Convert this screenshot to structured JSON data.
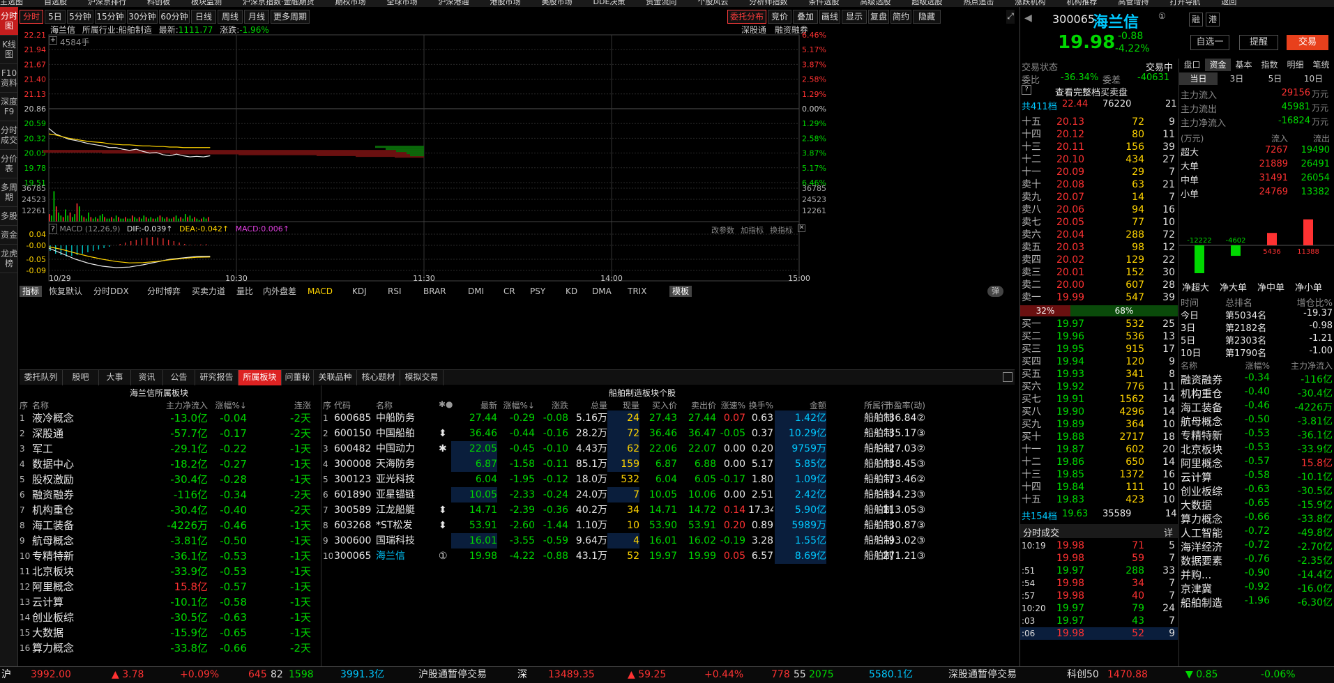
{
  "menu": [
    "主选图",
    "自选股",
    "沪深京排行",
    "科创板",
    "板块监测",
    "沪深京指数·金融期货",
    "期权市场",
    "全球市场",
    "沪深港通",
    "港股市场",
    "美股市场",
    "DDE决策",
    "资金流向",
    "个股风云",
    "分析师指数",
    "条件选股",
    "高级选股",
    "超级选股",
    "热点追击",
    "涨跌机构",
    "机构推荐",
    "高管增持",
    "打开导航",
    "返回"
  ],
  "sidebar": [
    {
      "label": "分时图",
      "active": true
    },
    {
      "label": "K线图"
    },
    {
      "label": "F10资料"
    },
    {
      "label": "深度F9"
    },
    {
      "label": "分时成交"
    },
    {
      "label": "分价表"
    },
    {
      "label": "多周期"
    },
    {
      "label": "多股"
    },
    {
      "label": "资金"
    },
    {
      "label": "龙虎榜"
    }
  ],
  "toolbar": {
    "left": [
      "分时",
      "5日",
      "5分钟",
      "15分钟",
      "30分钟",
      "60分钟",
      "日线",
      "周线",
      "月线",
      "更多周期"
    ],
    "right": [
      "委托分布",
      "竞价",
      "叠加",
      "画线",
      "显示",
      "复盘",
      "简约",
      "隐藏"
    ]
  },
  "chart": {
    "title": "海兰信",
    "industry_label": "所属行业:",
    "industry": "船舶制造",
    "latest_label": "最新:",
    "latest": "1111.77",
    "chg_label": "涨跌:",
    "chg": "-1.96%",
    "link1": "深股通",
    "link2": "融资融券",
    "volume_marker": "4584手",
    "price_ticks": [
      "22.21",
      "21.94",
      "21.67",
      "21.40",
      "21.13",
      "20.86",
      "20.59",
      "20.32",
      "20.05",
      "19.78",
      "19.51"
    ],
    "pct_ticks": [
      "6.46%",
      "5.17%",
      "3.87%",
      "2.58%",
      "1.29%",
      "0.00%",
      "1.29%",
      "2.58%",
      "3.87%",
      "5.17%",
      "6.46%"
    ],
    "vol_ticks": [
      "36785",
      "24523",
      "12261"
    ],
    "macd_label": "MACD (12,26,9)",
    "dif": "DIF:-0.039↑",
    "dea": "DEA:-0.042↑",
    "macd": "MACD:0.006↑",
    "macd_ticks": [
      "0.04",
      "-0.00",
      "-0.05",
      "-0.09"
    ],
    "macd_links": [
      "改参数",
      "加指标",
      "换指标"
    ],
    "times": [
      "10/29",
      "10:30",
      "11:30",
      "14:00",
      "15:00"
    ],
    "indicators": [
      "指标",
      "恢复默认",
      "分时DDX",
      "分时博弈",
      "买卖力道",
      "量比",
      "内外盘差",
      "MACD",
      "KDJ",
      "RSI",
      "BRAR",
      "DMI",
      "CR",
      "PSY",
      "KD",
      "DMA",
      "TRIX",
      "模板"
    ],
    "toggle": "弹",
    "price_line": [
      20.5,
      20.4,
      20.35,
      20.3,
      20.28,
      20.25,
      20.22,
      20.2,
      20.18,
      20.15,
      20.15,
      20.12,
      20.1,
      20.12,
      20.08,
      20.05,
      20.06,
      20.02,
      20.0,
      20.03,
      20.0,
      19.98,
      19.99,
      19.98,
      20.0
    ],
    "avg_line": [
      20.4,
      20.38,
      20.35,
      20.32,
      20.3,
      20.28,
      20.26,
      20.25,
      20.24,
      20.22,
      20.21,
      20.2,
      20.2,
      20.19,
      20.18,
      20.18,
      20.17,
      20.17,
      20.16,
      20.16,
      20.15,
      20.15,
      20.15,
      20.15,
      20.15
    ],
    "vols": [
      5,
      4,
      20,
      10,
      6,
      4,
      3,
      8,
      4,
      6,
      3,
      5,
      12,
      10,
      4,
      3,
      2,
      6,
      3,
      2,
      3,
      2,
      4,
      5,
      3,
      2,
      2,
      3,
      2,
      4,
      3,
      2,
      2,
      3,
      2,
      2,
      4,
      3,
      2,
      3,
      2,
      4,
      3,
      2,
      3,
      2,
      2,
      3,
      4,
      3,
      2,
      3,
      2,
      2,
      3,
      4,
      2,
      3,
      2,
      5,
      3,
      4,
      2,
      3,
      2,
      1,
      2,
      3,
      2,
      3
    ],
    "macd_bars": [
      -0.02,
      -0.03,
      -0.035,
      -0.04,
      -0.038,
      -0.035,
      -0.03,
      -0.025,
      -0.02,
      -0.015,
      -0.01,
      -0.005,
      0.0,
      0.005,
      0.01,
      0.015,
      0.02,
      0.025,
      0.028,
      0.03,
      0.028,
      0.025,
      0.02,
      0.015,
      0.01,
      0.005,
      0.002,
      0.001,
      0.003,
      0.004
    ],
    "dif_line": [
      -0.01,
      -0.03,
      -0.05,
      -0.065,
      -0.075,
      -0.08,
      -0.078,
      -0.07,
      -0.06,
      -0.05,
      -0.045,
      -0.04,
      -0.039
    ],
    "dea_line": [
      -0.005,
      -0.015,
      -0.028,
      -0.04,
      -0.05,
      -0.058,
      -0.063,
      -0.062,
      -0.058,
      -0.052,
      -0.047,
      -0.043,
      -0.042
    ],
    "depth_green": [
      8,
      10,
      16,
      22,
      28
    ],
    "depth_red": [
      6,
      14,
      22,
      38,
      52,
      66,
      78
    ]
  },
  "btabs": [
    "委托队列",
    "股吧",
    "大事",
    "资讯",
    "公告",
    "研究报告",
    "所属板块",
    "问董秘",
    "关联品种",
    "核心题材",
    "模拟交易"
  ],
  "left_table": {
    "title": "海兰信所属板块",
    "headers": [
      "序",
      "名称",
      "主力净流入",
      "涨幅%↓",
      "连涨"
    ],
    "rows": [
      [
        "1",
        "液冷概念",
        "-13.0亿",
        "-0.04",
        "-2天"
      ],
      [
        "2",
        "深股通",
        "-57.7亿",
        "-0.17",
        "-2天"
      ],
      [
        "3",
        "军工",
        "-29.1亿",
        "-0.22",
        "-1天"
      ],
      [
        "4",
        "数据中心",
        "-18.2亿",
        "-0.27",
        "-1天"
      ],
      [
        "5",
        "股权激励",
        "-30.4亿",
        "-0.28",
        "-1天"
      ],
      [
        "6",
        "融资融券",
        "-116亿",
        "-0.34",
        "-2天"
      ],
      [
        "7",
        "机构重仓",
        "-30.4亿",
        "-0.40",
        "-2天"
      ],
      [
        "8",
        "海工装备",
        "-4226万",
        "-0.46",
        "-1天"
      ],
      [
        "9",
        "航母概念",
        "-3.81亿",
        "-0.50",
        "-1天"
      ],
      [
        "10",
        "专精特新",
        "-36.1亿",
        "-0.53",
        "-1天"
      ],
      [
        "11",
        "北京板块",
        "-33.9亿",
        "-0.53",
        "-1天"
      ],
      [
        "12",
        "阿里概念",
        "15.8亿",
        "-0.57",
        "-1天"
      ],
      [
        "13",
        "云计算",
        "-10.1亿",
        "-0.58",
        "-1天"
      ],
      [
        "14",
        "创业板综",
        "-30.5亿",
        "-0.63",
        "-1天"
      ],
      [
        "15",
        "大数据",
        "-15.9亿",
        "-0.65",
        "-1天"
      ],
      [
        "16",
        "算力概念",
        "-33.8亿",
        "-0.66",
        "-2天"
      ]
    ]
  },
  "right_table": {
    "title": "船舶制造板块个股",
    "headers": [
      "序",
      "代码",
      "名称",
      "✱●",
      "最新",
      "涨幅%↓",
      "涨跌",
      "总量",
      "现量",
      "买入价",
      "卖出价",
      "涨速%",
      "换手%",
      "金额",
      "市盈率(动)",
      "所属行"
    ],
    "rows": [
      [
        "1",
        "600685",
        "中船防务",
        "",
        "27.44",
        "-0.29",
        "-0.08",
        "5.16万",
        "24",
        "27.43",
        "27.44",
        "0.07",
        "0.63",
        "1.42亿",
        "36.84②",
        "船舶制"
      ],
      [
        "2",
        "600150",
        "中国船舶",
        "⬍",
        "36.46",
        "-0.44",
        "-0.16",
        "28.2万",
        "72",
        "36.46",
        "36.47",
        "-0.05",
        "0.37",
        "10.29亿",
        "35.17③",
        "船舶制"
      ],
      [
        "3",
        "600482",
        "中国动力",
        "✱",
        "22.05",
        "-0.45",
        "-0.10",
        "4.43万",
        "62",
        "22.06",
        "22.07",
        "0.00",
        "0.20",
        "9759万",
        "27.03②",
        "船舶制"
      ],
      [
        "4",
        "300008",
        "天海防务",
        "",
        "6.87",
        "-1.58",
        "-0.11",
        "85.1万",
        "159",
        "6.87",
        "6.88",
        "0.00",
        "5.17",
        "5.85亿",
        "38.45③",
        "船舶制"
      ],
      [
        "5",
        "300123",
        "亚光科技",
        "",
        "6.04",
        "-1.95",
        "-0.12",
        "18.0万",
        "532",
        "6.04",
        "6.05",
        "-0.17",
        "1.80",
        "1.09亿",
        "-73.46②",
        "船舶制"
      ],
      [
        "6",
        "601890",
        "亚星锚链",
        "",
        "10.05",
        "-2.33",
        "-0.24",
        "24.0万",
        "7",
        "10.05",
        "10.06",
        "0.00",
        "2.51",
        "2.42亿",
        "34.23③",
        "船舶制"
      ],
      [
        "7",
        "300589",
        "江龙船艇",
        "⬍",
        "14.71",
        "-2.39",
        "-0.36",
        "40.2万",
        "34",
        "14.71",
        "14.72",
        "0.14",
        "17.34",
        "5.90亿",
        "-113.05③",
        "船舶制"
      ],
      [
        "8",
        "603268",
        "*ST松发",
        "⬍",
        "53.91",
        "-2.60",
        "-1.44",
        "1.10万",
        "10",
        "53.90",
        "53.91",
        "0.20",
        "0.89",
        "5989万",
        "30.87③",
        "船舶制"
      ],
      [
        "9",
        "300600",
        "国瑞科技",
        "",
        "16.01",
        "-3.55",
        "-0.59",
        "9.64万",
        "4",
        "16.01",
        "16.02",
        "-0.19",
        "3.28",
        "1.55亿",
        "-93.02③",
        "船舶制"
      ],
      [
        "10",
        "300065",
        "海兰信",
        "①",
        "19.98",
        "-4.22",
        "-0.88",
        "43.1万",
        "52",
        "19.97",
        "19.99",
        "0.05",
        "6.57",
        "8.69亿",
        "271.21③",
        "船舶制"
      ]
    ]
  },
  "stock": {
    "code": "300065",
    "name": "海兰信",
    "price": "19.98",
    "change": "-0.88",
    "pct": "-4.22%",
    "btn1": "融",
    "btn2": "港",
    "zixuan": "自选一",
    "tixing": "提醒",
    "trade": "交易",
    "status_label": "交易状态",
    "status": "交易中",
    "weibi_label": "委比",
    "weibi": "-36.34%",
    "weicha_label": "委差",
    "weicha": "-40631",
    "full_book": "查看完整档买卖盘",
    "sell_total_label": "共411档",
    "sell_total_price": "22.44",
    "sell_total_vol": "76220",
    "sell_total_n": "21",
    "sells": [
      [
        "十五",
        "20.13",
        "72",
        "9"
      ],
      [
        "十四",
        "20.12",
        "80",
        "11"
      ],
      [
        "十三",
        "20.11",
        "156",
        "39"
      ],
      [
        "十二",
        "20.10",
        "434",
        "27"
      ],
      [
        "十一",
        "20.09",
        "29",
        "7"
      ],
      [
        "卖十",
        "20.08",
        "63",
        "21"
      ],
      [
        "卖九",
        "20.07",
        "14",
        "7"
      ],
      [
        "卖八",
        "20.06",
        "94",
        "16"
      ],
      [
        "卖七",
        "20.05",
        "77",
        "10"
      ],
      [
        "卖六",
        "20.04",
        "288",
        "72"
      ],
      [
        "卖五",
        "20.03",
        "98",
        "12"
      ],
      [
        "卖四",
        "20.02",
        "129",
        "22"
      ],
      [
        "卖三",
        "20.01",
        "152",
        "30"
      ],
      [
        "卖二",
        "20.00",
        "607",
        "28"
      ],
      [
        "卖一",
        "19.99",
        "547",
        "39"
      ]
    ],
    "ratio_left": "32%",
    "ratio_right": "68%",
    "buys": [
      [
        "买一",
        "19.97",
        "532",
        "25"
      ],
      [
        "买二",
        "19.96",
        "536",
        "13"
      ],
      [
        "买三",
        "19.95",
        "915",
        "17"
      ],
      [
        "买四",
        "19.94",
        "120",
        "9"
      ],
      [
        "买五",
        "19.93",
        "341",
        "8"
      ],
      [
        "买六",
        "19.92",
        "776",
        "11"
      ],
      [
        "买七",
        "19.91",
        "1562",
        "14"
      ],
      [
        "买八",
        "19.90",
        "4296",
        "14"
      ],
      [
        "买九",
        "19.89",
        "364",
        "10"
      ],
      [
        "买十",
        "19.88",
        "2717",
        "18"
      ],
      [
        "十一",
        "19.87",
        "602",
        "20"
      ],
      [
        "十二",
        "19.86",
        "650",
        "14"
      ],
      [
        "十三",
        "19.85",
        "1372",
        "16"
      ],
      [
        "十四",
        "19.84",
        "111",
        "10"
      ],
      [
        "十五",
        "19.83",
        "423",
        "10"
      ]
    ],
    "buy_total_label": "共154档",
    "buy_total_price": "19.63",
    "buy_total_vol": "35589",
    "buy_total_n": "14",
    "ticks_title": "分时成交",
    "ticks_btn": "详",
    "ticks": [
      [
        "10:19",
        "19.98",
        "71",
        "5"
      ],
      [
        "",
        "19.98",
        "59",
        "7"
      ],
      [
        ":51",
        "19.97",
        "288",
        "33"
      ],
      [
        ":54",
        "19.98",
        "34",
        "7"
      ],
      [
        ":57",
        "19.98",
        "40",
        "7"
      ],
      [
        "10:20",
        "19.97",
        "79",
        "24"
      ],
      [
        ":03",
        "19.97",
        "43",
        "7"
      ],
      [
        ":06",
        "19.98",
        "52",
        "9"
      ]
    ]
  },
  "fund": {
    "tabs": [
      "盘口",
      "资金",
      "基本",
      "指数",
      "明细",
      "笔统"
    ],
    "periods": [
      "当日",
      "3日",
      "5日",
      "10日"
    ],
    "main_in_label": "主力流入",
    "main_in": "29156",
    "main_out_label": "主力流出",
    "main_out": "45981",
    "main_net_label": "主力净流入",
    "main_net": "-16824",
    "unit": "万元",
    "flow_hdr": [
      "(万元)",
      "流入",
      "流出"
    ],
    "flows": [
      [
        "超大",
        "7267",
        "19490"
      ],
      [
        "大单",
        "21889",
        "26491"
      ],
      [
        "中单",
        "31491",
        "26054"
      ],
      [
        "小单",
        "24769",
        "13382"
      ]
    ],
    "net_bars": [
      -12222,
      -4602,
      5436,
      11388
    ],
    "net_labels": [
      "净超大",
      "净大单",
      "净中单",
      "净小单"
    ],
    "rank_hdr": [
      "时间",
      "总排名",
      "增仓比%"
    ],
    "ranks": [
      [
        "今日",
        "第5034名",
        "-19.37"
      ],
      [
        "3日",
        "第2182名",
        "-0.98"
      ],
      [
        "5日",
        "第2303名",
        "-1.21"
      ],
      [
        "10日",
        "第1790名",
        "-1.00"
      ]
    ],
    "sect_hdr": [
      "名称",
      "涨幅%",
      "主力净流入"
    ],
    "sectors": [
      [
        "融资融券",
        "-0.34",
        "-116亿"
      ],
      [
        "机构重仓",
        "-0.40",
        "-30.4亿"
      ],
      [
        "海工装备",
        "-0.46",
        "-4226万"
      ],
      [
        "航母概念",
        "-0.50",
        "-3.81亿"
      ],
      [
        "专精特新",
        "-0.53",
        "-36.1亿"
      ],
      [
        "北京板块",
        "-0.53",
        "-33.9亿"
      ],
      [
        "阿里概念",
        "-0.57",
        "15.8亿"
      ],
      [
        "云计算",
        "-0.58",
        "-10.1亿"
      ],
      [
        "创业板综",
        "-0.63",
        "-30.5亿"
      ],
      [
        "大数据",
        "-0.65",
        "-15.9亿"
      ],
      [
        "算力概念",
        "-0.66",
        "-33.8亿"
      ],
      [
        "人工智能",
        "-0.72",
        "-49.8亿"
      ],
      [
        "海洋经济",
        "-0.72",
        "-2.70亿"
      ],
      [
        "数据要素",
        "-0.76",
        "-2.35亿"
      ],
      [
        "并购...",
        "-0.90",
        "-14.4亿"
      ],
      [
        "京津冀",
        "-0.92",
        "-16.0亿"
      ],
      [
        "船舶制造",
        "-1.96",
        "-6.30亿"
      ]
    ]
  },
  "statusbar": {
    "sh": "沪",
    "sh_idx": "3992.00",
    "sh_chg": "▲ 3.78",
    "sh_pct": "+0.09%",
    "sh_up": "645",
    "sh_mid": "82",
    "sh_down": "1598",
    "sh_amt": "3991.3亿",
    "hk1": "沪股通暂停交易",
    "sz": "深",
    "sz_idx": "13489.35",
    "sz_chg": "▲ 59.25",
    "sz_pct": "+0.44%",
    "sz_up": "778",
    "sz_mid": "55",
    "sz_down": "2075",
    "sz_amt": "5580.1亿",
    "hk2": "深股通暂停交易",
    "kc": "科创50",
    "kc_idx": "1470.88",
    "kc_chg": "▼ 0.85",
    "kc_pct": "-0.06%"
  }
}
